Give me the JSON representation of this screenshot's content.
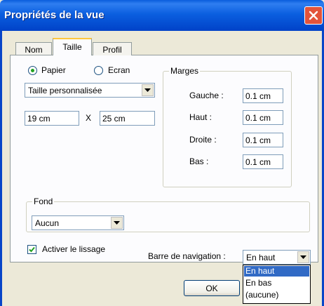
{
  "window": {
    "title": "Propriétés de la vue"
  },
  "tabs": [
    {
      "label": "Nom"
    },
    {
      "label": "Taille"
    },
    {
      "label": "Profil"
    }
  ],
  "paper": {
    "radio_papier": "Papier",
    "radio_ecran": "Ecran",
    "selected": "Papier",
    "size_select": "Taille personnalisée",
    "width": "19 cm",
    "times": "X",
    "height": "25 cm"
  },
  "margins": {
    "title": "Marges",
    "gauche_label": "Gauche :",
    "gauche_value": "0.1 cm",
    "haut_label": "Haut :",
    "haut_value": "0.1 cm",
    "droite_label": "Droite :",
    "droite_value": "0.1 cm",
    "bas_label": "Bas :",
    "bas_value": "0.1 cm"
  },
  "fond": {
    "title": "Fond",
    "value": "Aucun"
  },
  "smoothing": {
    "label": "Activer le lissage",
    "checked": true
  },
  "navbar": {
    "label": "Barre de navigation :",
    "value": "En haut",
    "options": [
      "En haut",
      "En bas",
      "(aucune)"
    ],
    "selected_index": 0
  },
  "buttons": {
    "ok": "OK"
  },
  "colors": {
    "title_bar": "#0a5ddc",
    "selection": "#316ac5",
    "close": "#e3533a"
  }
}
